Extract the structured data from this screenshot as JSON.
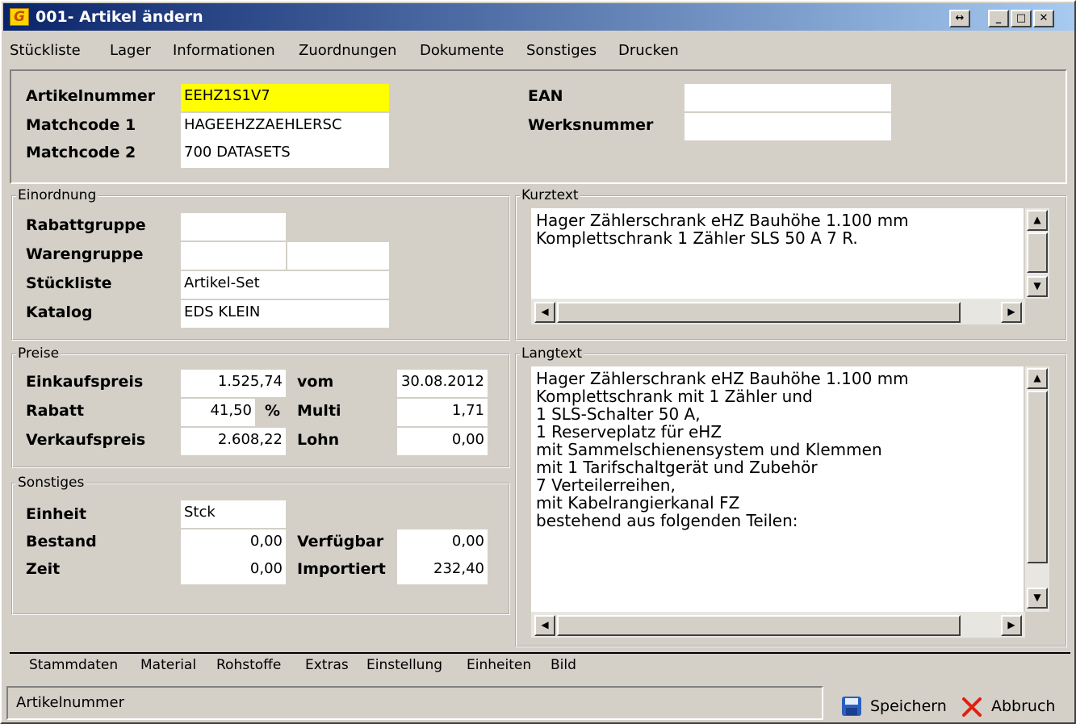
{
  "window": {
    "title": "001- Artikel ändern",
    "resize_glyph": "↔"
  },
  "menu": [
    "Stückliste",
    "Lager",
    "Informationen",
    "Zuordnungen",
    "Dokumente",
    "Sonstiges",
    "Drucken"
  ],
  "header": {
    "artikelnummer_label": "Artikelnummer",
    "artikelnummer_value": "EEHZ1S1V7",
    "matchcode1_label": "Matchcode 1",
    "matchcode1_value": "HAGEEHZZAEHLERSC",
    "matchcode2_label": "Matchcode 2",
    "matchcode2_value": "700 DATASETS",
    "ean_label": "EAN",
    "ean_value": "",
    "werksnummer_label": "Werksnummer",
    "werksnummer_value": ""
  },
  "einordnung": {
    "legend": "Einordnung",
    "rabattgruppe_label": "Rabattgruppe",
    "rabattgruppe_value": "",
    "warengruppe_label": "Warengruppe",
    "warengruppe_value1": "",
    "warengruppe_value2": "",
    "stueckliste_label": "Stückliste",
    "stueckliste_value": "Artikel-Set",
    "katalog_label": "Katalog",
    "katalog_value": "EDS KLEIN"
  },
  "preise": {
    "legend": "Preise",
    "einkaufspreis_label": "Einkaufspreis",
    "einkaufspreis_value": "1.525,74",
    "vom_label": "vom",
    "vom_value": "30.08.2012",
    "rabatt_label": "Rabatt",
    "rabatt_value": "41,50",
    "percent": "%",
    "multi_label": "Multi",
    "multi_value": "1,71",
    "verkaufspreis_label": "Verkaufspreis",
    "verkaufspreis_value": "2.608,22",
    "lohn_label": "Lohn",
    "lohn_value": "0,00"
  },
  "sonstiges": {
    "legend": "Sonstiges",
    "einheit_label": "Einheit",
    "einheit_value": "Stck",
    "bestand_label": "Bestand",
    "bestand_value": "0,00",
    "verfuegbar_label": "Verfügbar",
    "verfuegbar_value": "0,00",
    "zeit_label": "Zeit",
    "zeit_value": "0,00",
    "importiert_label": "Importiert",
    "importiert_value": "232,40"
  },
  "kurztext": {
    "legend": "Kurztext",
    "text": "Hager Zählerschrank eHZ Bauhöhe 1.100 mm\nKomplettschrank 1 Zähler SLS 50 A 7 R."
  },
  "langtext": {
    "legend": "Langtext",
    "text": "Hager Zählerschrank eHZ Bauhöhe 1.100 mm\nKomplettschrank mit 1 Zähler und\n1 SLS-Schalter 50 A,\n1 Reserveplatz für eHZ\nmit Sammelschienensystem und Klemmen\nmit 1 Tarifschaltgerät und Zubehör\n7 Verteilerreihen,\nmit Kabelrangierkanal FZ\nbestehend aus folgenden Teilen:"
  },
  "tabs": [
    "Stammdaten",
    "Material",
    "Rohstoffe",
    "Extras",
    "Einstellung",
    "Einheiten",
    "Bild"
  ],
  "status": {
    "text": "Artikelnummer"
  },
  "buttons": {
    "save": "Speichern",
    "cancel": "Abbruch"
  },
  "colors": {
    "active_field": "#ffff00",
    "titlebar": "#0a246a",
    "save_icon": "#2a5fbf",
    "cancel_icon": "#e02010"
  }
}
